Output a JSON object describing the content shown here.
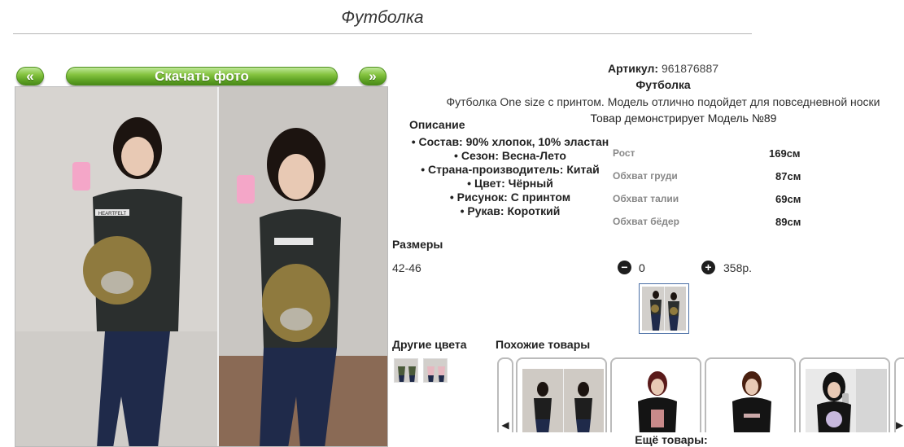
{
  "title": "Футболка",
  "gallery": {
    "prev_label": "«",
    "download_label": "Скачать фото",
    "next_label": "»",
    "shirt_print": "HEARTFELT"
  },
  "product": {
    "sku_label": "Артикул:",
    "sku_value": "961876887",
    "name": "Футболка",
    "description": "Футболка One size с принтом. Модель отлично подойдет для повседневной носки",
    "model_note": "Товар демонстрирует Модель №89"
  },
  "description_block": {
    "heading": "Описание",
    "items": [
      "Состав: 90% хлопок, 10% эластан",
      "Сезон: Весна-Лето",
      "Страна-производитель: Китай",
      "Цвет: Чёрный",
      "Рисунок: С принтом",
      "Рукав: Короткий"
    ]
  },
  "measurements": [
    {
      "label": "Рост",
      "value": "169см"
    },
    {
      "label": "Обхват груди",
      "value": "87см"
    },
    {
      "label": "Обхват талии",
      "value": "69см"
    },
    {
      "label": "Обхват бёдер",
      "value": "89см"
    }
  ],
  "sizes": {
    "heading": "Размеры",
    "size": "42-46",
    "minus_icon": "minus-circle-icon",
    "quantity": "0",
    "plus_icon": "plus-circle-icon",
    "price": "358р."
  },
  "other_colors": {
    "heading": "Другие цвета"
  },
  "similar": {
    "heading": "Похожие товары",
    "left_arrow": "◀",
    "right_arrow": "▶"
  },
  "more_label": "Ещё товары:",
  "colors": {
    "accent_green": "#5ea324",
    "shirt": "#2b2f2e",
    "jeans": "#1f2a4a",
    "wall": "#d9d6d2"
  }
}
